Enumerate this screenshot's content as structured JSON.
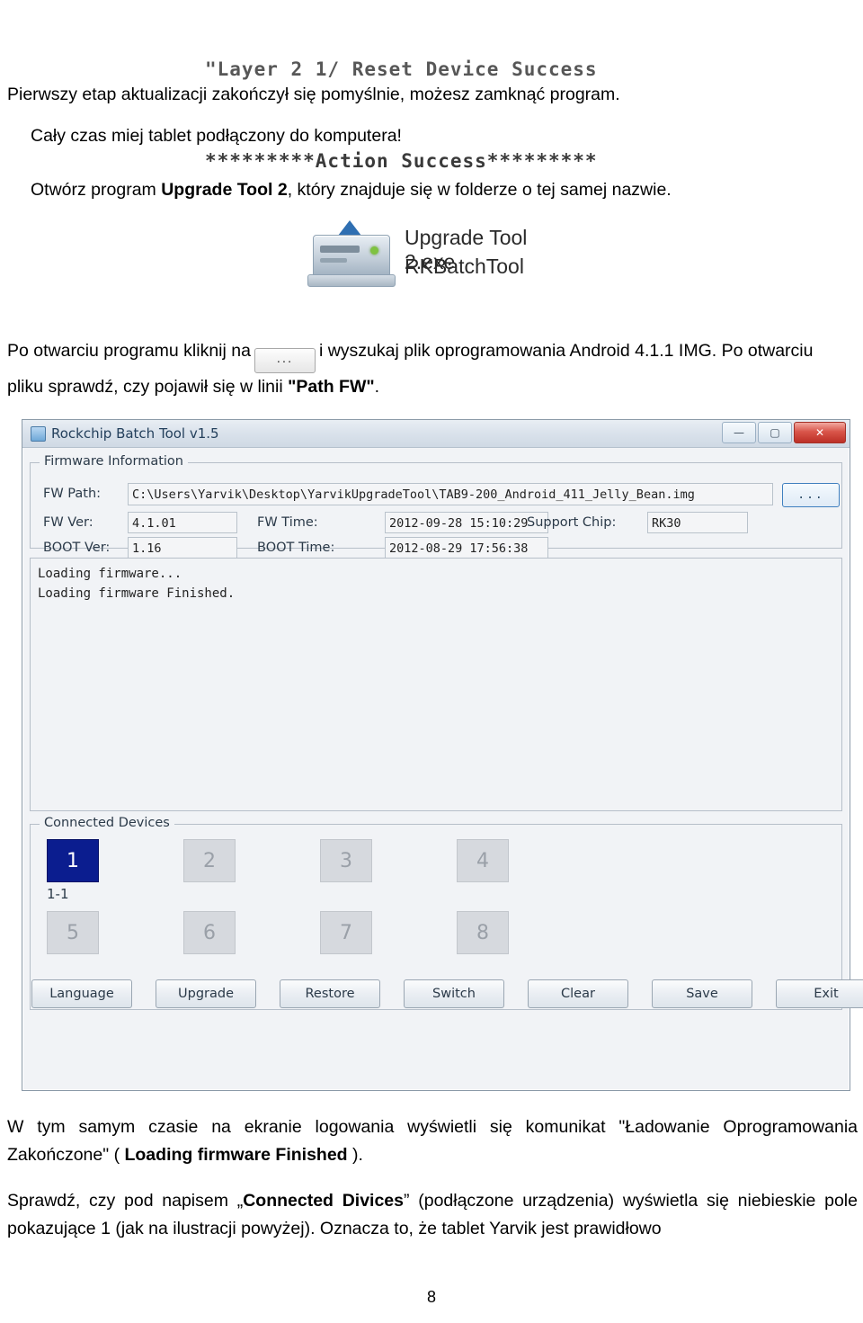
{
  "console": {
    "line1": "\"Layer 2 1/ Reset Device Success",
    "line2": "*********Action Success*********"
  },
  "doc": {
    "p1": "Pierwszy etap aktualizacji zakończył się pomyślnie, możesz zamknąć program.",
    "p2": "Cały czas miej tablet podłączony do komputera!",
    "p3_pre": "Otwórz program ",
    "p3_bold": "Upgrade Tool 2",
    "p3_post": ", który znajduje się w folderze o tej samej nazwie.",
    "p4_pre": "Po otwarciu programu  kliknij na",
    "p4_btn": "...",
    "p4_mid": "i wyszukaj plik oprogramowania Android 4.1.1 IMG. Po otwarciu pliku sprawdź, czy pojawił się w linii ",
    "p4_bold": "\"Path FW\"",
    "p4_end": ".",
    "p5_a": "W tym samym czasie na ekranie logowania wyświetli się komunikat \"Ładowanie Oprogramowania Zakończone\" ( ",
    "p5_bold": "Loading firmware Finished",
    "p5_b": " ).",
    "p6_a": "Sprawdź, czy pod napisem „",
    "p6_bold1": "Connected Divices",
    "p6_b": "” (podłączone urządzenia) wyświetla się niebieskie pole pokazujące 1 (jak na ilustracji powyżej).  Oznacza to, że tablet Yarvik jest  prawidłowo",
    "page_number": "8"
  },
  "tool_icon": {
    "label_exe": "Upgrade Tool 2.exe",
    "label_sub": "RKBatchTool"
  },
  "rk_window": {
    "title": "Rockchip Batch Tool v1.5",
    "window_buttons": {
      "minimize": "—",
      "maximize": "▢",
      "close": "✕"
    },
    "firmware_group": {
      "legend": "Firmware Information",
      "fw_path_label": "FW Path:",
      "fw_path_value": "C:\\Users\\Yarvik\\Desktop\\YarvikUpgradeTool\\TAB9-200_Android_411_Jelly_Bean.img",
      "browse_button": "...",
      "fw_ver_label": "FW Ver:",
      "fw_ver_value": "4.1.01",
      "fw_time_label": "FW Time:",
      "fw_time_value": "2012-09-28 15:10:29",
      "support_chip_label": "Support Chip:",
      "support_chip_value": "RK30",
      "boot_ver_label": "BOOT Ver:",
      "boot_ver_value": "1.16",
      "boot_time_label": "BOOT Time:",
      "boot_time_value": "2012-08-29 17:56:38"
    },
    "log": {
      "line1": "Loading firmware...",
      "line2": "Loading firmware Finished."
    },
    "devices_group": {
      "legend": "Connected Devices",
      "row1": [
        {
          "num": "1",
          "active": true,
          "sub": "1-1"
        },
        {
          "num": "2",
          "active": false,
          "sub": ""
        },
        {
          "num": "3",
          "active": false,
          "sub": ""
        },
        {
          "num": "4",
          "active": false,
          "sub": ""
        }
      ],
      "row2": [
        {
          "num": "5",
          "active": false,
          "sub": ""
        },
        {
          "num": "6",
          "active": false,
          "sub": ""
        },
        {
          "num": "7",
          "active": false,
          "sub": ""
        },
        {
          "num": "8",
          "active": false,
          "sub": ""
        }
      ]
    },
    "buttons": [
      "Language",
      "Upgrade",
      "Restore",
      "Switch",
      "Clear",
      "Save",
      "Exit"
    ],
    "colors": {
      "active_device": "#0b1d8f",
      "close_button": "#bc2f26",
      "title_text": "#24405c"
    }
  }
}
